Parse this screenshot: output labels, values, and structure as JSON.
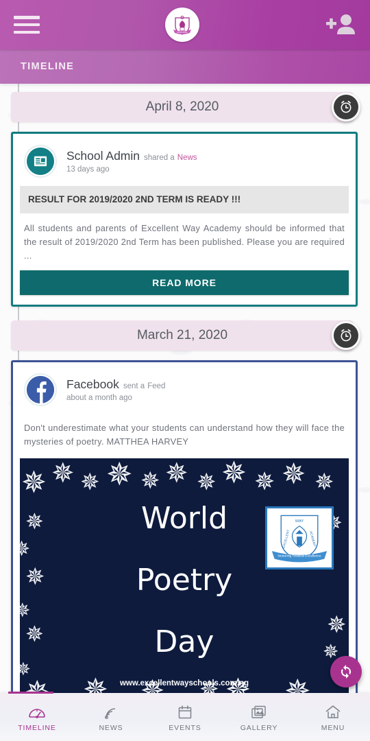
{
  "header": {
    "menu_icon": "hamburger-menu-icon",
    "logo_icon": "school-crest-logo",
    "add_user_icon": "add-person-icon",
    "subbar_title": "TIMELINE",
    "gradient_from": "#b95ab0",
    "gradient_to": "#a33a9e"
  },
  "timeline": {
    "groups": [
      {
        "date": "April 8, 2020",
        "clock_icon": "alarm-clock-icon",
        "post": {
          "type": "news",
          "border_color": "#117c80",
          "avatar_icon": "newspaper-icon",
          "avatar_color": "#128086",
          "author": "School Admin",
          "action": "shared a",
          "kind": "News",
          "time": "13 days ago",
          "title": "RESULT FOR 2019/2020 2ND TERM IS READY !!!",
          "body": "All students and parents of Excellent Way Academy should be informed that the result of 2019/2020 2nd Term has been published. Please you are required ...",
          "button_label": "READ MORE",
          "button_color": "#0e6a6c"
        }
      },
      {
        "date": "March 21, 2020",
        "clock_icon": "alarm-clock-icon",
        "post": {
          "type": "feed",
          "border_color": "#3c5393",
          "avatar_icon": "facebook-icon",
          "avatar_color": "#3b5ca8",
          "author": "Facebook",
          "action": "sent a",
          "kind": "Feed",
          "time": "about a month ago",
          "body": "Don't underestimate what your students can understand how they will face the mysteries of poetry. MATTHEA HARVEY",
          "image": {
            "alt": "world-poetry-day-poster",
            "background_color": "#0e1b3d",
            "line1": "World",
            "line2": "Poetry",
            "line3": "Day",
            "url": "www.excellentwayschools.com.ng",
            "crest": {
              "top_label": "WAY",
              "left_label": "EXCELLENT",
              "right_label": "ACADEMY",
              "ribbon": "Nurturing Towards Excellence"
            }
          }
        }
      }
    ]
  },
  "fab": {
    "icon": "refresh-sync-icon",
    "color": "#a8338f"
  },
  "bottom_nav": {
    "active_color": "#a8338f",
    "items": [
      {
        "label": "TIMELINE",
        "icon": "speedometer-icon",
        "active": true
      },
      {
        "label": "NEWS",
        "icon": "rss-feed-icon",
        "active": false
      },
      {
        "label": "EVENTS",
        "icon": "calendar-icon",
        "active": false
      },
      {
        "label": "GALLERY",
        "icon": "photos-icon",
        "active": false
      },
      {
        "label": "MENU",
        "icon": "home-icon",
        "active": false
      }
    ]
  }
}
